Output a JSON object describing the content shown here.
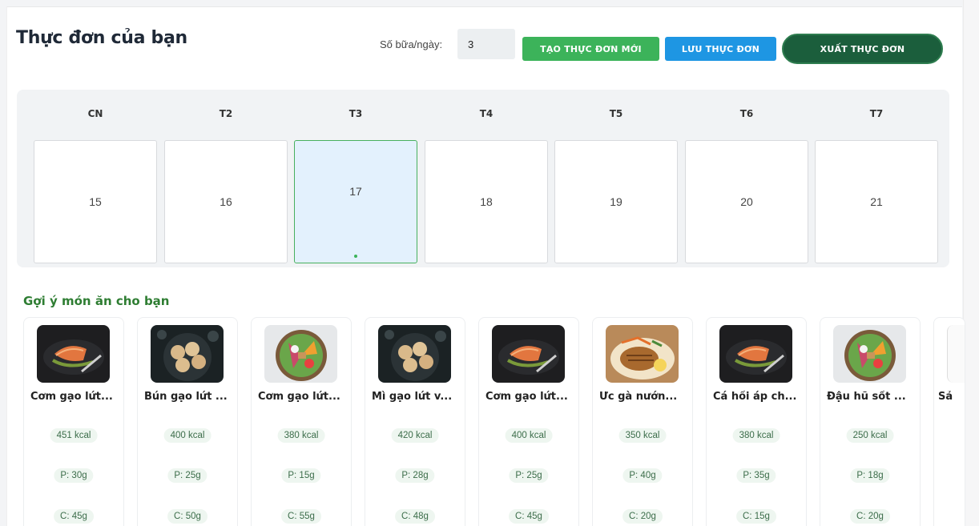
{
  "header": {
    "title": "Thực đơn của bạn",
    "meals_label": "Số bữa/ngày:",
    "meals_value": "3",
    "new_menu_label": "TẠO THỰC ĐƠN MỚI",
    "save_menu_label": "LƯU THỰC ĐƠN",
    "export_menu_label": "XUẤT THỰC ĐƠN"
  },
  "calendar": {
    "weekdays": [
      "CN",
      "T2",
      "T3",
      "T4",
      "T5",
      "T6",
      "T7"
    ],
    "days": [
      "15",
      "16",
      "17",
      "18",
      "19",
      "20",
      "21"
    ],
    "selected_day": "17"
  },
  "suggestions": {
    "title": "Gợi ý món ăn cho bạn",
    "items": [
      {
        "name": "Cơm gạo lứt...",
        "kcal": "451 kcal",
        "protein": "P: 30g",
        "carbs": "C: 45g",
        "image": "salmon-dish"
      },
      {
        "name": "Bún gạo lứt ...",
        "kcal": "400 kcal",
        "protein": "P: 25g",
        "carbs": "C: 50g",
        "image": "dumplings-dish"
      },
      {
        "name": "Cơm gạo lứt...",
        "kcal": "380 kcal",
        "protein": "P: 15g",
        "carbs": "C: 55g",
        "image": "salad-bowl"
      },
      {
        "name": "Mì gạo lứt v...",
        "kcal": "420 kcal",
        "protein": "P: 28g",
        "carbs": "C: 48g",
        "image": "dumplings-dish"
      },
      {
        "name": "Cơm gạo lứt...",
        "kcal": "400 kcal",
        "protein": "P: 25g",
        "carbs": "C: 45g",
        "image": "salmon-dish"
      },
      {
        "name": "Ức gà nướn...",
        "kcal": "350 kcal",
        "protein": "P: 40g",
        "carbs": "C: 20g",
        "image": "grilled-chicken"
      },
      {
        "name": "Cá hồi áp ch...",
        "kcal": "380 kcal",
        "protein": "P: 35g",
        "carbs": "C: 15g",
        "image": "salmon-dish"
      },
      {
        "name": "Đậu hũ sốt ...",
        "kcal": "250 kcal",
        "protein": "P: 18g",
        "carbs": "C: 20g",
        "image": "salad-bowl"
      },
      {
        "name": "Sả",
        "kcal": "",
        "protein": "",
        "carbs": "",
        "image": "blank"
      }
    ]
  },
  "colors": {
    "primary_green": "#3cb35a",
    "dark_green": "#1b5e3c",
    "blue": "#1e96e3",
    "section_title": "#2e7d32"
  }
}
